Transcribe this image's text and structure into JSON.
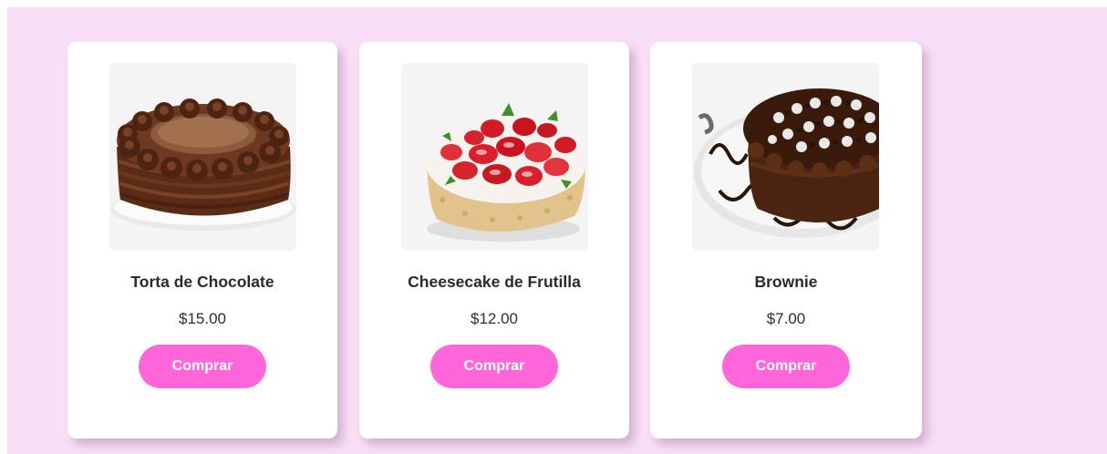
{
  "products": [
    {
      "name": "Torta de Chocolate",
      "price": "$15.00",
      "button_label": "Comprar",
      "image_icon": "chocolate-cake-image"
    },
    {
      "name": "Cheesecake de Frutilla",
      "price": "$12.00",
      "button_label": "Comprar",
      "image_icon": "strawberry-cheesecake-image"
    },
    {
      "name": "Brownie",
      "price": "$7.00",
      "button_label": "Comprar",
      "image_icon": "brownie-image"
    }
  ],
  "colors": {
    "background": "#f8def6",
    "card": "#ffffff",
    "button": "#ff66d9",
    "button_text": "#ffffff",
    "text": "#2b2b2b"
  }
}
